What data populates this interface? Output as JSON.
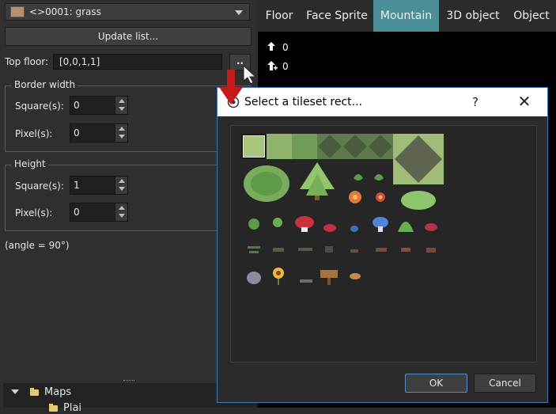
{
  "left_panel": {
    "map_selector": {
      "value": "<>0001: grass",
      "swatch_color": "#b8906e"
    },
    "update_button": "Update list...",
    "top_floor": {
      "label": "Top floor:",
      "value": "[0,0,1,1]",
      "button": ".."
    },
    "border_width": {
      "title": "Border width",
      "squares_label": "Square(s):",
      "squares_value": "0",
      "pixels_label": "Pixel(s):",
      "pixels_value": "0"
    },
    "height": {
      "title": "Height",
      "squares_label": "Square(s):",
      "squares_value": "1",
      "pixels_label": "Pixel(s):",
      "pixels_value": "0"
    },
    "angle_text": "(angle = 90°)",
    "tree": {
      "root_label": "Maps",
      "child_label": "Plai"
    }
  },
  "tabs": [
    "Floor",
    "Face Sprite",
    "Mountain",
    "3D object",
    "Object"
  ],
  "active_tab": "Mountain",
  "map_view": {
    "line1": "0",
    "line2": "0"
  },
  "dialog": {
    "title": "Select a tileset rect...",
    "help": "?",
    "close": "✕",
    "ok": "OK",
    "cancel": "Cancel"
  },
  "colors": {
    "accent": "#4a8f98",
    "dialog_border": "#3d7ab8",
    "highlight_arrow": "#c41a1a"
  }
}
